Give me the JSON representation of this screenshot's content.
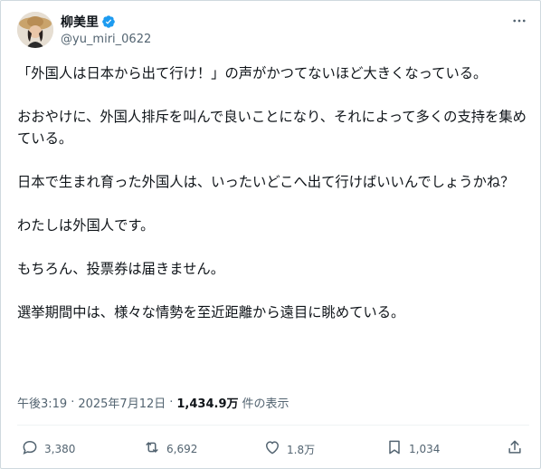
{
  "author": {
    "display_name": "柳美里",
    "handle": "@yu_miri_0622"
  },
  "tweet": {
    "paragraphs": [
      "「外国人は日本から出て行け！」の声がかつてないほど大きくなっている。",
      "おおやけに、外国人排斥を叫んで良いことになり、それによって多くの支持を集めている。",
      "日本で生まれ育った外国人は、いったいどこへ出て行けばいいんでしょうかね？",
      "わたしは外国人です。",
      "もちろん、投票券は届きません。",
      "選挙期間中は、様々な情勢を至近距離から遠目に眺めている。"
    ]
  },
  "meta": {
    "time": "午後3:19",
    "separator": "·",
    "date": "2025年7月12日",
    "views_count": "1,434.9万",
    "views_label": "件の表示"
  },
  "actions": {
    "reply_count": "3,380",
    "repost_count": "6,692",
    "like_count": "1.8万",
    "bookmark_count": "1,034"
  },
  "icons": {
    "verified": "verified-badge-icon",
    "more": "more-icon",
    "reply": "reply-icon",
    "repost": "repost-icon",
    "like": "heart-icon",
    "bookmark": "bookmark-icon",
    "share": "share-icon"
  },
  "colors": {
    "text_primary": "#0f1419",
    "text_secondary": "#536471",
    "verified_blue": "#1d9bf0",
    "border": "#cfd9de"
  }
}
